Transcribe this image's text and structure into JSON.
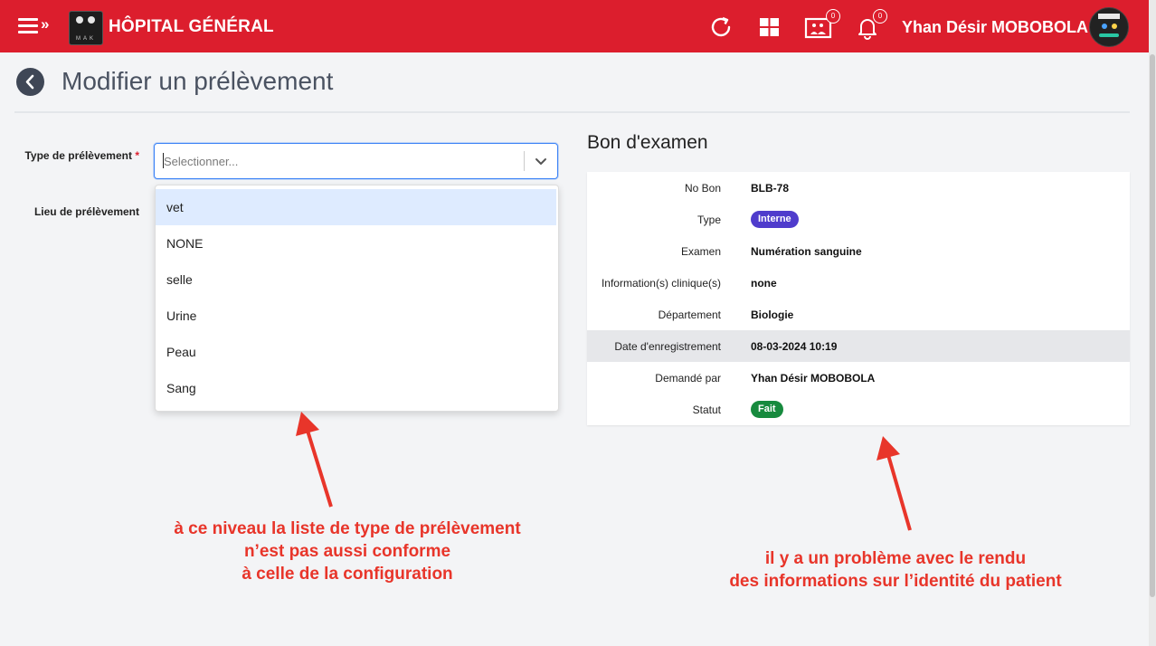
{
  "header": {
    "app_title": "HÔPITAL GÉNÉRAL",
    "logo_text": "MAK",
    "user_name": "Yhan Désir MOBOBOLA",
    "icons": [
      "menu-icon",
      "refresh-icon",
      "grid-icon",
      "message-icon",
      "bell-icon"
    ],
    "message_count": "0",
    "notification_count": "0",
    "color": "#dc1e2d"
  },
  "page": {
    "title": "Modifier un prélèvement"
  },
  "form": {
    "type_label": "Type de prélèvement",
    "required_mark": "*",
    "lieu_label": "Lieu de prélèvement",
    "select_placeholder": "Selectionner...",
    "options": [
      "vet",
      "NONE",
      "selle",
      "Urine",
      "Peau",
      "Sang"
    ],
    "highlighted_option": "vet"
  },
  "exam": {
    "section_title": "Bon d'examen",
    "rows": [
      {
        "key": "No Bon",
        "value": "BLB-78"
      },
      {
        "key": "Type",
        "value": "Interne",
        "pill_color": "#4f3ccc"
      },
      {
        "key": "Examen",
        "value": "Numération sanguine"
      },
      {
        "key": "Information(s) clinique(s)",
        "value": "none"
      },
      {
        "key": "Département",
        "value": "Biologie"
      },
      {
        "key": "Date d'enregistrement",
        "value": "08-03-2024 10:19"
      },
      {
        "key": "Demandé par",
        "value": "Yhan Désir MOBOBOLA"
      },
      {
        "key": "Statut",
        "value": "Fait",
        "pill_color": "#178a3e"
      }
    ]
  },
  "annotations": {
    "left_lines": [
      "à ce niveau la liste de type de prélèvement",
      "n’est pas aussi conforme",
      "à celle de la configuration"
    ],
    "right_lines": [
      "il y a un problème avec le rendu",
      "des informations sur l’identité du patient"
    ],
    "color": "#e8352a"
  }
}
